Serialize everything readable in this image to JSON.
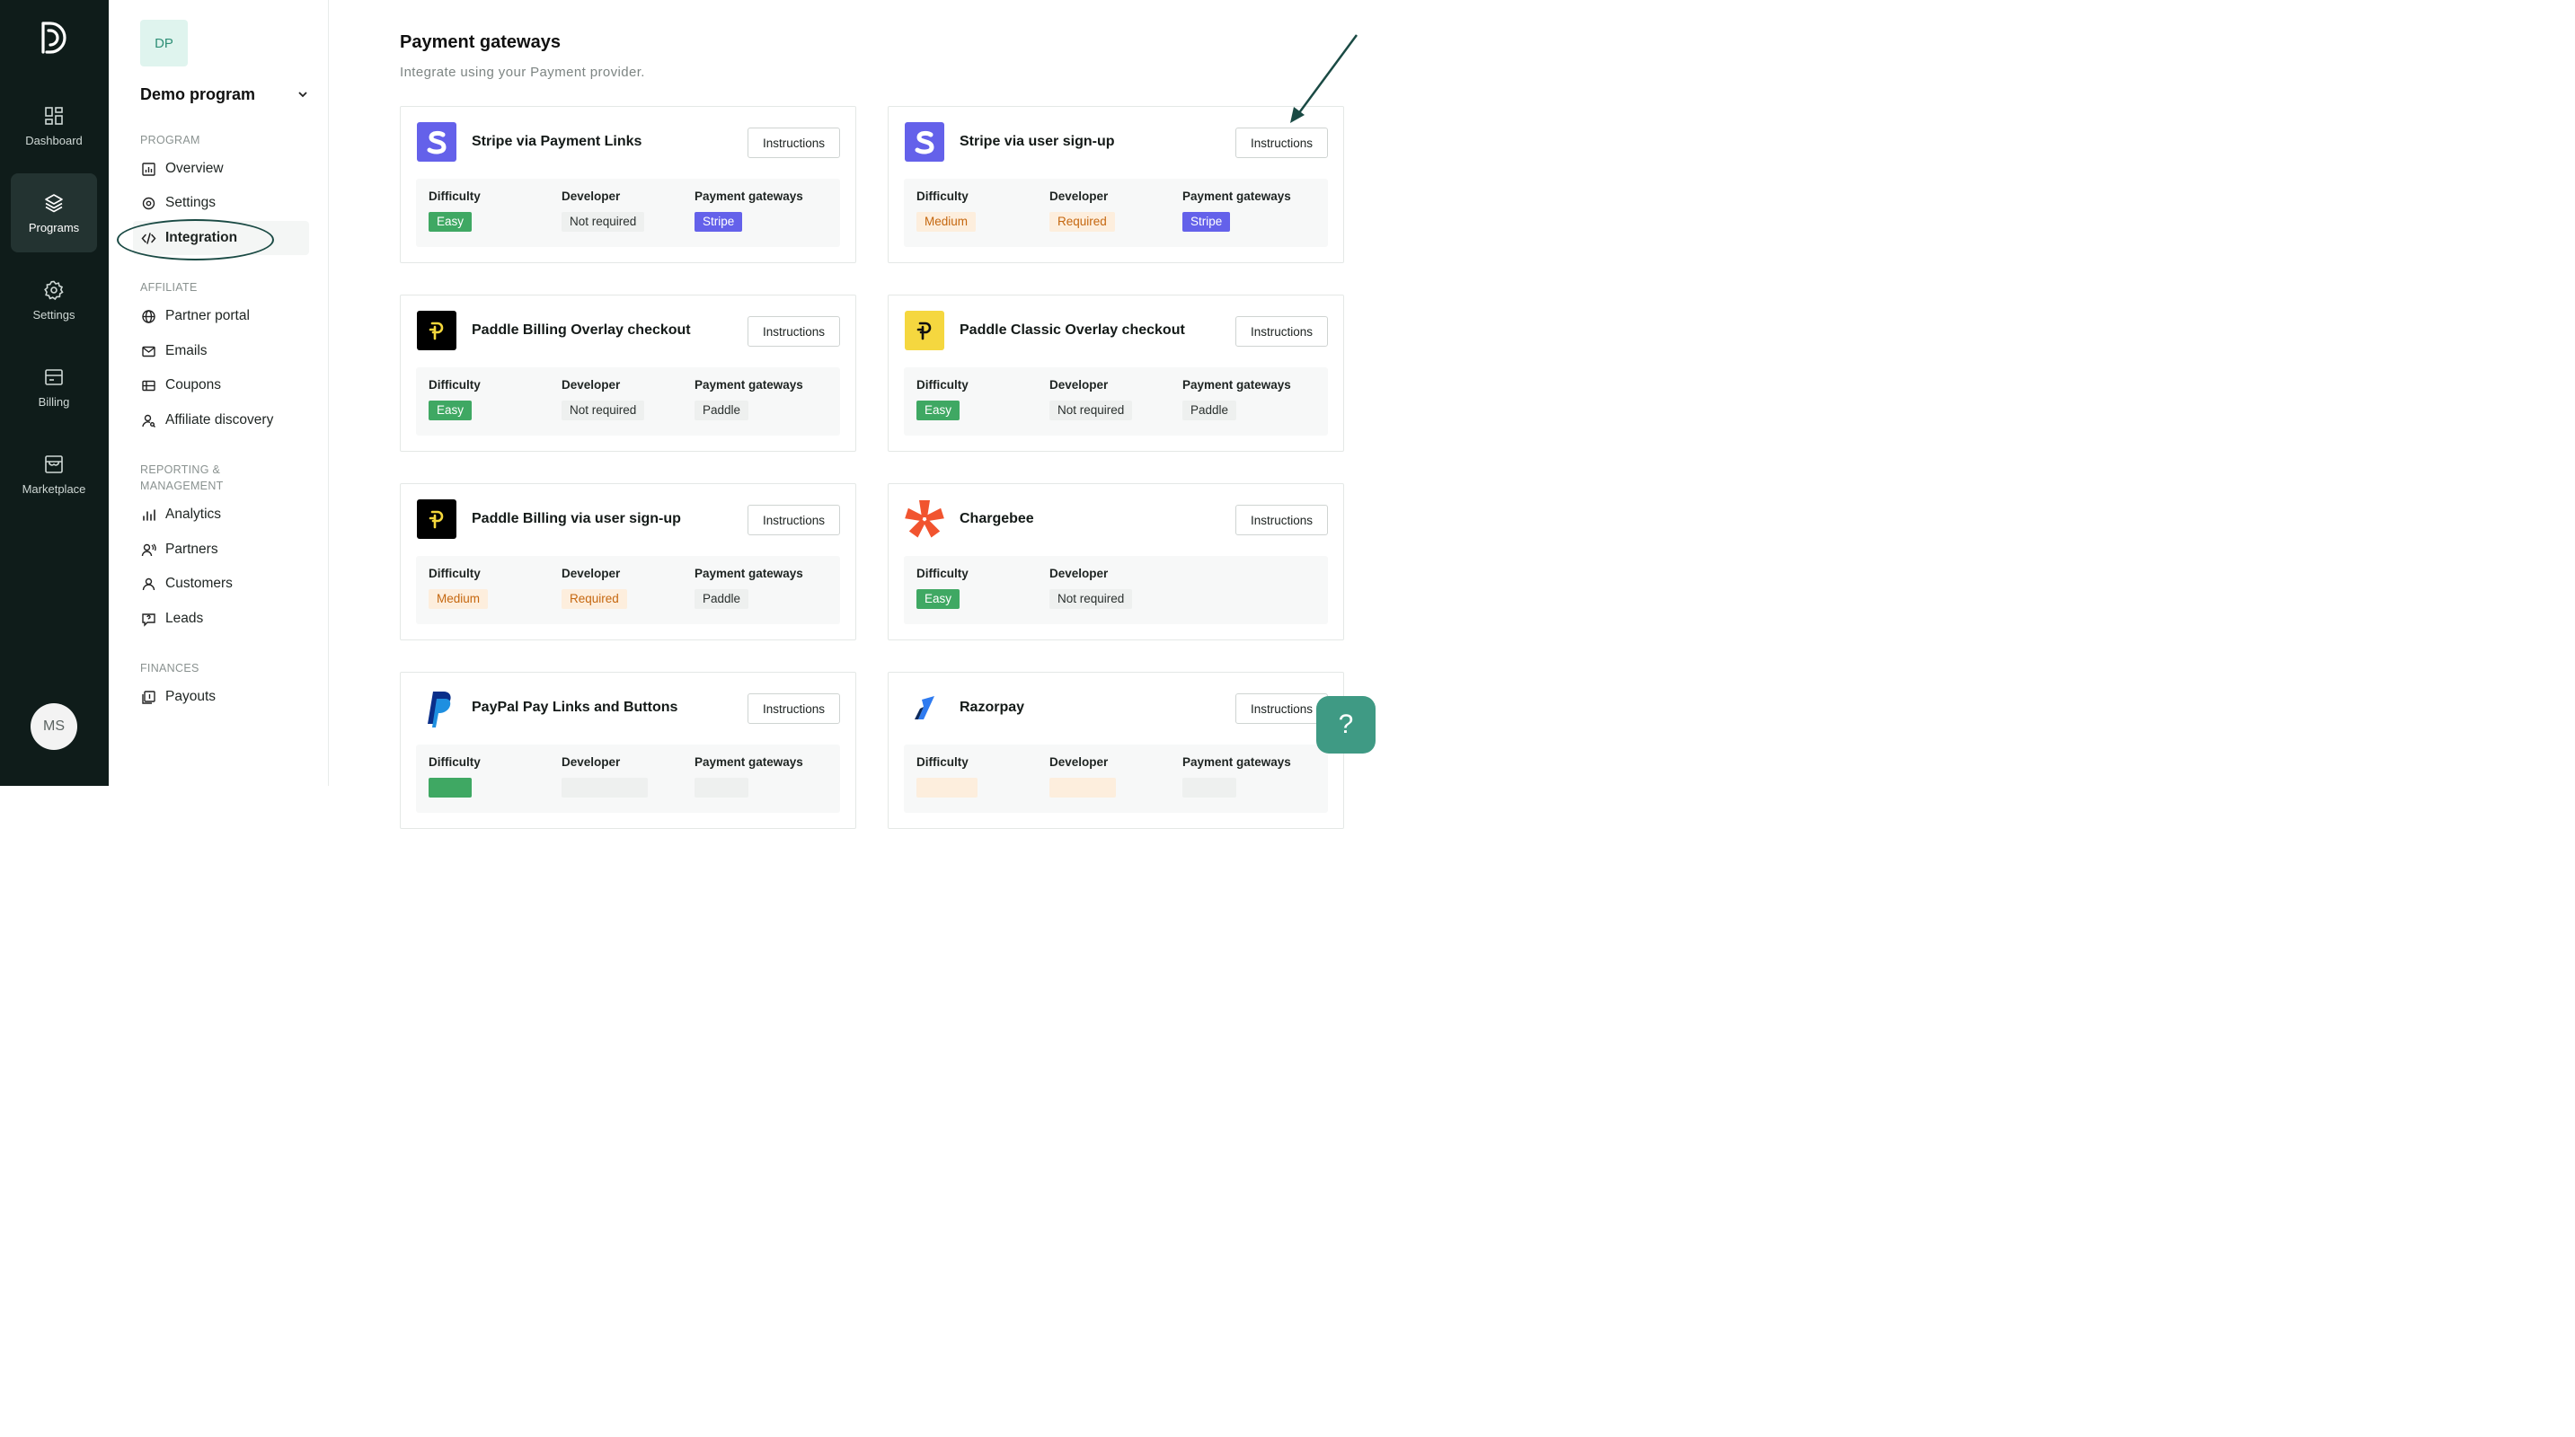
{
  "rail": {
    "items": [
      {
        "label": "Dashboard",
        "icon": "dashboard-icon"
      },
      {
        "label": "Programs",
        "icon": "layers-icon"
      },
      {
        "label": "Settings",
        "icon": "gear-icon"
      },
      {
        "label": "Billing",
        "icon": "billing-icon"
      },
      {
        "label": "Marketplace",
        "icon": "store-icon"
      }
    ],
    "active": "Programs",
    "avatar": "MS"
  },
  "sidebar": {
    "badge": "DP",
    "program_name": "Demo program",
    "sections": {
      "program": "PROGRAM",
      "affiliate": "AFFILIATE",
      "reporting_1": "REPORTING &",
      "reporting_2": "MANAGEMENT",
      "finances": "FINANCES"
    },
    "items": {
      "overview": "Overview",
      "settings": "Settings",
      "integration": "Integration",
      "partner_portal": "Partner portal",
      "emails": "Emails",
      "coupons": "Coupons",
      "affiliate_discovery": "Affiliate discovery",
      "analytics": "Analytics",
      "partners": "Partners",
      "customers": "Customers",
      "leads": "Leads",
      "payouts": "Payouts"
    },
    "active": "Integration"
  },
  "main": {
    "title": "Payment gateways",
    "subtitle": "Integrate using your Payment provider.",
    "labels": {
      "difficulty": "Difficulty",
      "developer": "Developer",
      "gateways": "Payment gateways",
      "instructions": "Instructions"
    },
    "cards": [
      {
        "title": "Stripe via Payment Links",
        "difficulty": "Easy",
        "developer": "Not required",
        "gateway": "Stripe"
      },
      {
        "title": "Stripe via user sign-up",
        "difficulty": "Medium",
        "developer": "Required",
        "gateway": "Stripe"
      },
      {
        "title": "Paddle Billing Overlay checkout",
        "difficulty": "Easy",
        "developer": "Not required",
        "gateway": "Paddle"
      },
      {
        "title": "Paddle Classic Overlay checkout",
        "difficulty": "Easy",
        "developer": "Not required",
        "gateway": "Paddle"
      },
      {
        "title": "Paddle Billing via user sign-up",
        "difficulty": "Medium",
        "developer": "Required",
        "gateway": "Paddle"
      },
      {
        "title": "Chargebee",
        "difficulty": "Easy",
        "developer": "Not required",
        "gateway": ""
      },
      {
        "title": "PayPal Pay Links and Buttons",
        "difficulty": "",
        "developer": "",
        "gateway": ""
      },
      {
        "title": "Razorpay",
        "difficulty": "",
        "developer": "",
        "gateway": ""
      }
    ]
  },
  "help": "?",
  "colors": {
    "rail_bg": "#0f1c1a",
    "accent": "#3f9a84",
    "easy": "#3fa863",
    "medium_bg": "#fdeedd",
    "stripe": "#6461ea"
  }
}
